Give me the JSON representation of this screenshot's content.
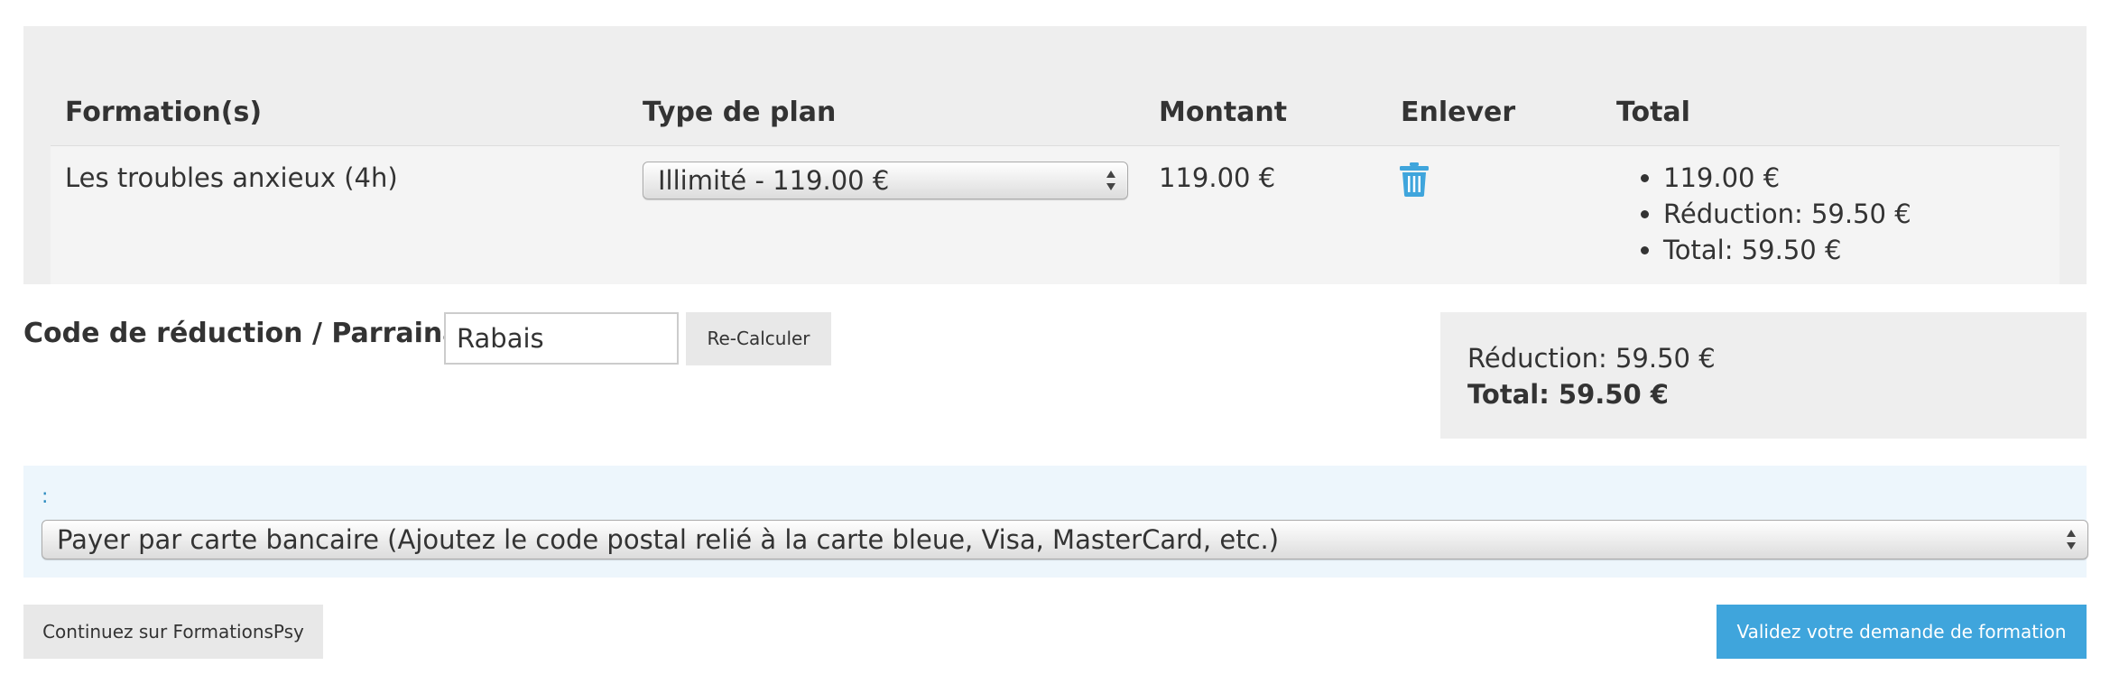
{
  "cart": {
    "headers": {
      "course": "Formation(s)",
      "plan": "Type de plan",
      "amount": "Montant",
      "remove": "Enlever",
      "total": "Total"
    },
    "rows": [
      {
        "course": "Les troubles anxieux (4h)",
        "plan_selected": "Illimité - 119.00 €",
        "amount": "119.00 €",
        "remove_icon": "trash-icon",
        "summary": [
          "119.00 €",
          "Réduction: 59.50 €",
          "Total: 59.50 €"
        ]
      }
    ]
  },
  "promo": {
    "label": "Code de réduction / Parrainage:",
    "input_value": "Rabais",
    "recalc_label": "Re-Calculer"
  },
  "totals": {
    "discount": "Réduction: 59.50 €",
    "total": "Total: 59.50 €"
  },
  "payment": {
    "label": ":",
    "selected": "Payer par carte bancaire (Ajoutez le code postal relié à la carte bleue, Visa, MasterCard, etc.)"
  },
  "actions": {
    "continue_label": "Continuez sur FormationsPsy",
    "submit_label": "Validez votre demande de formation"
  },
  "colors": {
    "accent": "#3fa5dc",
    "panel": "#eeeeee",
    "payment_bg": "#edf6fc"
  }
}
